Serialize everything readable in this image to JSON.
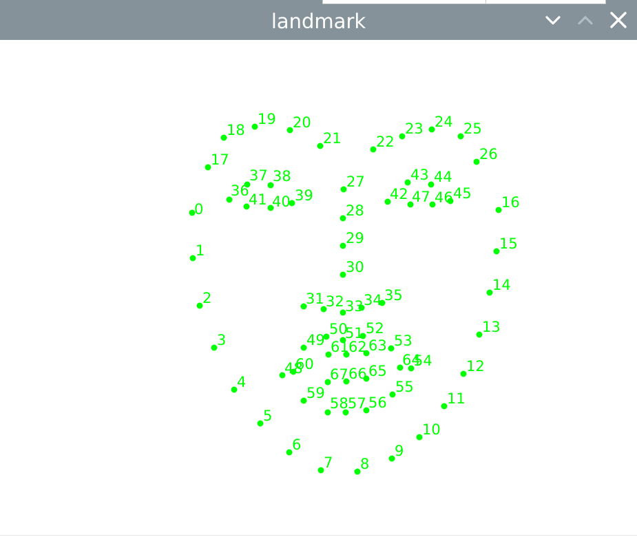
{
  "window": {
    "title": "landmark",
    "controls": [
      {
        "name": "minimize-button",
        "icon": "chevron-down-icon"
      },
      {
        "name": "maximize-button",
        "icon": "chevron-up-icon"
      },
      {
        "name": "close-button",
        "icon": "close-icon"
      }
    ]
  },
  "colors": {
    "titlebar": "#86929a",
    "title_text": "#ffffff",
    "landmark": "#00ff00",
    "background": "#ffffff"
  },
  "landmarks": [
    "0",
    "1",
    "2",
    "3",
    "4",
    "5",
    "6",
    "7",
    "8",
    "9",
    "10",
    "11",
    "12",
    "13",
    "14",
    "15",
    "16",
    "17",
    "18",
    "19",
    "20",
    "21",
    "22",
    "23",
    "24",
    "25",
    "26",
    "27",
    "28",
    "29",
    "30",
    "31",
    "32",
    "33",
    "34",
    "35",
    "36",
    "37",
    "38",
    "39",
    "40",
    "41",
    "42",
    "43",
    "44",
    "45",
    "46",
    "47",
    "48",
    "49",
    "50",
    "51",
    "52",
    "53",
    "54",
    "55",
    "56",
    "57",
    "58",
    "59",
    "60",
    "61",
    "62",
    "63",
    "64",
    "65",
    "66",
    "67"
  ]
}
